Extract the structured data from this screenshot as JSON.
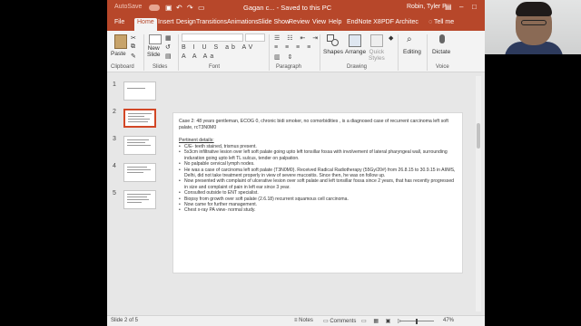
{
  "titlebar": {
    "autosave": "AutoSave",
    "document_title": "Gagan c... - Saved to this PC",
    "user_name": "Robin, Tyler P",
    "accent_color": "#b7472a"
  },
  "ribbon_tabs": [
    "File",
    "Home",
    "Insert",
    "Design",
    "Transitions",
    "Animations",
    "Slide Show",
    "Review",
    "View",
    "Help",
    "EndNote X8",
    "PDF Architec"
  ],
  "active_tab": "Home",
  "tell_me": "Tell me",
  "ribbon": {
    "paste": "Paste",
    "new_slide": "New\nSlide",
    "shapes": "Shapes",
    "arrange": "Arrange",
    "quick_styles": "Quick\nStyles",
    "editing": "Editing",
    "dictate": "Dictate",
    "groups": [
      "Clipboard",
      "Slides",
      "Font",
      "Paragraph",
      "Drawing",
      "Voice"
    ]
  },
  "thumbnails": [
    {
      "num": "1",
      "selected": false
    },
    {
      "num": "2",
      "selected": true
    },
    {
      "num": "3",
      "selected": false
    },
    {
      "num": "4",
      "selected": false
    },
    {
      "num": "5",
      "selected": false
    }
  ],
  "slide": {
    "case_text": "Case 2: 48 years gentleman, ECOG 0, chronic bidi smoker, no comorbidities , is a diagnosed case of  recurrent carcinoma left soft palate, rcT3N0M0",
    "pertinent_title": "Pertinent details:",
    "bullets": [
      "C/E- teeth stained, trismus present.",
      "5x3cm infiltrative lesion over left soft palate going upto left tonsillar fossa with involvement of lateral pharyngeal wall, surrounding induration going upto left TL sulcus, tender on palpation.",
      "No palpable cervical lymph nodes.",
      "He was a case of carcinoma left soft palate (T3N0M0). Received Radical Radiotherapy (55Gy/20#) from 26.8.15 to 30.9.15 in AIIMS, Delhi, did not take treatment properly in view of severe mucositis. Since then, he was on follow up.",
      "Now presented with complaint of ulcerative lesion over soft palate and left tonsillar fossa since 2 years, that has recently progressed in size and complaint of pain in left ear since 3 year.",
      "Consulted outside to ENT specialist.",
      "Biopsy from growth over soft palate (2.6.18) recurrent squamous cell carcinoma.",
      "Now came for further management.",
      "Chest x-ray PA view- normal study."
    ]
  },
  "statusbar": {
    "slide_info": "Slide 2 of 5",
    "notes": "Notes",
    "comments": "Comments",
    "zoom": "47%",
    "zoom_level_fraction": 0.47
  }
}
